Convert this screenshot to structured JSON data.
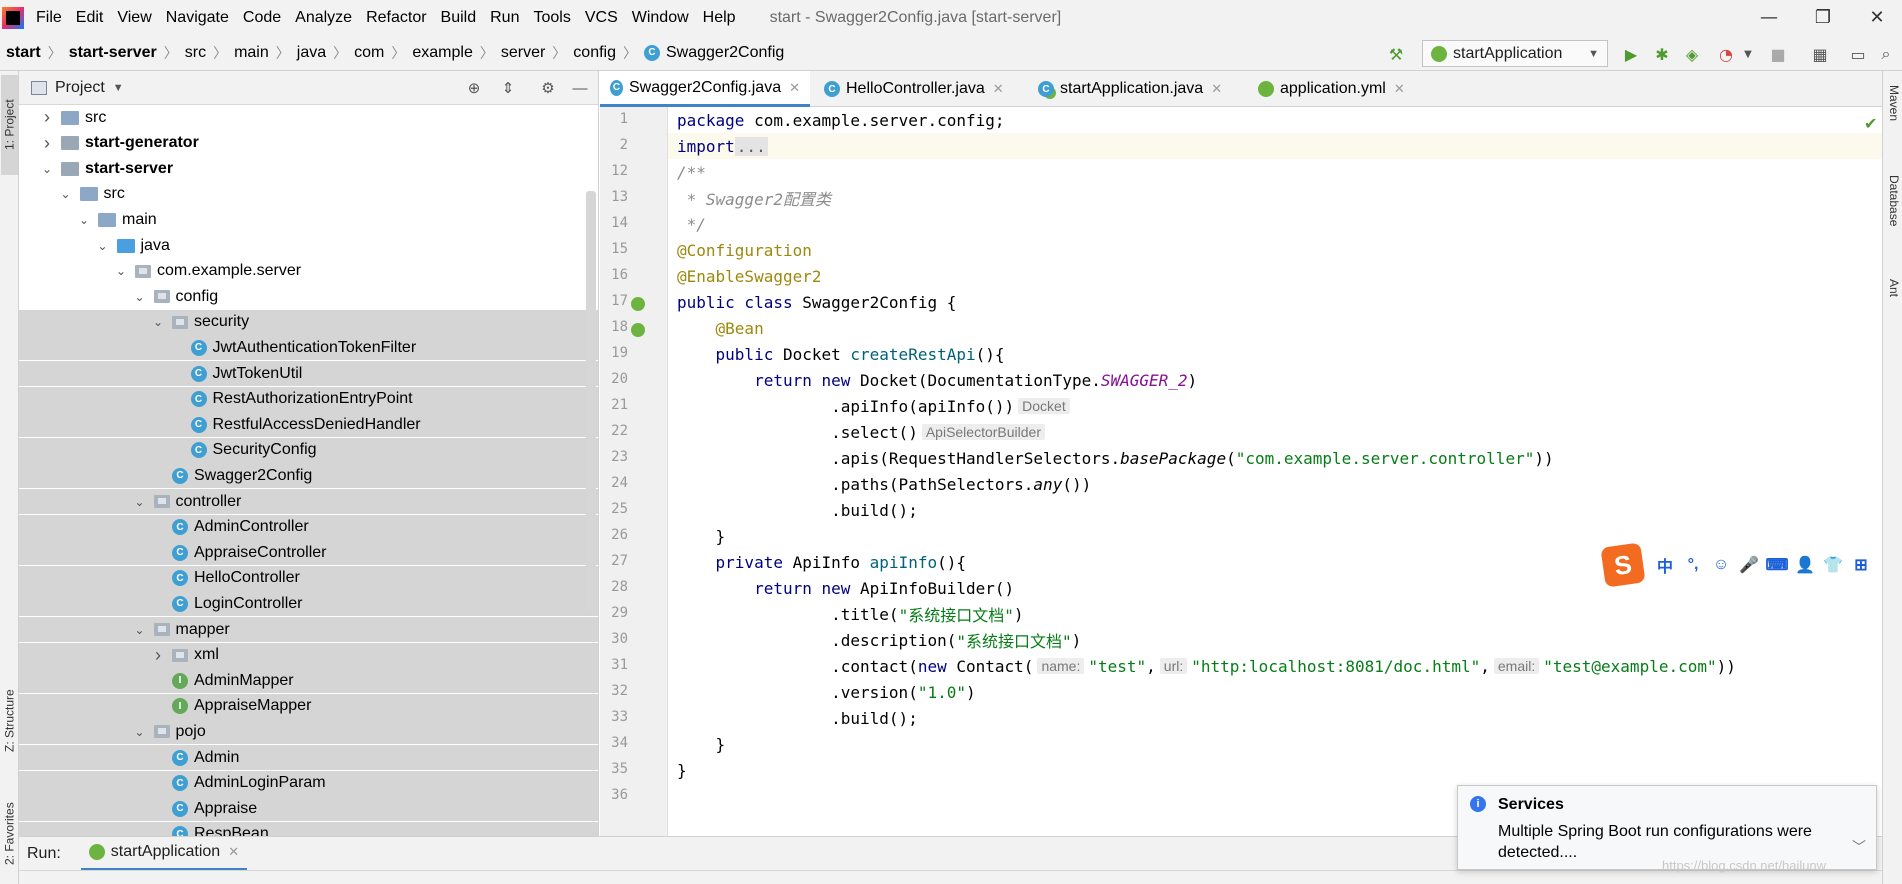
{
  "menubar": {
    "items": [
      "File",
      "Edit",
      "View",
      "Navigate",
      "Code",
      "Analyze",
      "Refactor",
      "Build",
      "Run",
      "Tools",
      "VCS",
      "Window",
      "Help"
    ],
    "window_title": "start - Swagger2Config.java [start-server]"
  },
  "breadcrumb": [
    "start",
    "start-server",
    "src",
    "main",
    "java",
    "com",
    "example",
    "server",
    "config",
    "Swagger2Config"
  ],
  "toolbar": {
    "run_config": "startApplication"
  },
  "left_tabs": [
    "1: Project",
    "Z: Structure",
    "2: Favorites"
  ],
  "right_tabs": [
    "Maven",
    "Database",
    "Ant"
  ],
  "project": {
    "title": "Project",
    "tree": [
      {
        "label": "src",
        "icon": "folder-icon",
        "depth": 1,
        "arrow": "right",
        "bold": false
      },
      {
        "label": "start-generator",
        "icon": "module-icon",
        "depth": 1,
        "arrow": "right",
        "bold": true
      },
      {
        "label": "start-server",
        "icon": "module-icon",
        "depth": 1,
        "arrow": "down",
        "bold": true
      },
      {
        "label": "src",
        "icon": "folder-icon",
        "depth": 2,
        "arrow": "down",
        "bold": false
      },
      {
        "label": "main",
        "icon": "folder-icon",
        "depth": 3,
        "arrow": "down",
        "bold": false
      },
      {
        "label": "java",
        "icon": "source-folder-icon",
        "depth": 4,
        "arrow": "down",
        "bold": false
      },
      {
        "label": "com.example.server",
        "icon": "package-icon",
        "depth": 5,
        "arrow": "down",
        "bold": false
      },
      {
        "label": "config",
        "icon": "package-icon",
        "depth": 6,
        "arrow": "down",
        "bold": false
      },
      {
        "label": "security",
        "icon": "package-icon",
        "depth": 7,
        "arrow": "down",
        "bold": false
      },
      {
        "label": "JwtAuthenticationTokenFilter",
        "icon": "class-icon",
        "depth": 8,
        "arrow": "",
        "bold": false
      },
      {
        "label": "JwtTokenUtil",
        "icon": "class-icon",
        "depth": 8,
        "arrow": "",
        "bold": false
      },
      {
        "label": "RestAuthorizationEntryPoint",
        "icon": "class-icon",
        "depth": 8,
        "arrow": "",
        "bold": false
      },
      {
        "label": "RestfulAccessDeniedHandler",
        "icon": "class-icon",
        "depth": 8,
        "arrow": "",
        "bold": false
      },
      {
        "label": "SecurityConfig",
        "icon": "class-icon",
        "depth": 8,
        "arrow": "",
        "bold": false
      },
      {
        "label": "Swagger2Config",
        "icon": "class-icon",
        "depth": 7,
        "arrow": "",
        "bold": false
      },
      {
        "label": "controller",
        "icon": "package-icon",
        "depth": 6,
        "arrow": "down",
        "bold": false
      },
      {
        "label": "AdminController",
        "icon": "class-icon",
        "depth": 7,
        "arrow": "",
        "bold": false
      },
      {
        "label": "AppraiseController",
        "icon": "class-icon",
        "depth": 7,
        "arrow": "",
        "bold": false
      },
      {
        "label": "HelloController",
        "icon": "class-icon",
        "depth": 7,
        "arrow": "",
        "bold": false
      },
      {
        "label": "LoginController",
        "icon": "class-icon",
        "depth": 7,
        "arrow": "",
        "bold": false
      },
      {
        "label": "mapper",
        "icon": "package-icon",
        "depth": 6,
        "arrow": "down",
        "bold": false
      },
      {
        "label": "xml",
        "icon": "package-icon",
        "depth": 7,
        "arrow": "right",
        "bold": false
      },
      {
        "label": "AdminMapper",
        "icon": "interface-icon",
        "depth": 7,
        "arrow": "",
        "bold": false
      },
      {
        "label": "AppraiseMapper",
        "icon": "interface-icon",
        "depth": 7,
        "arrow": "",
        "bold": false
      },
      {
        "label": "pojo",
        "icon": "package-icon",
        "depth": 6,
        "arrow": "down",
        "bold": false
      },
      {
        "label": "Admin",
        "icon": "class-icon",
        "depth": 7,
        "arrow": "",
        "bold": false
      },
      {
        "label": "AdminLoginParam",
        "icon": "class-icon",
        "depth": 7,
        "arrow": "",
        "bold": false
      },
      {
        "label": "Appraise",
        "icon": "class-icon",
        "depth": 7,
        "arrow": "",
        "bold": false
      },
      {
        "label": "RespBean",
        "icon": "class-icon",
        "depth": 7,
        "arrow": "",
        "bold": false
      }
    ]
  },
  "tabs": [
    {
      "label": "Swagger2Config.java",
      "icon": "class-icon",
      "active": true
    },
    {
      "label": "HelloController.java",
      "icon": "class-icon",
      "active": false
    },
    {
      "label": "startApplication.java",
      "icon": "spring-class-icon",
      "active": false
    },
    {
      "label": "application.yml",
      "icon": "spring-config-icon",
      "active": false
    }
  ],
  "editor": {
    "line_numbers": [
      "1",
      "2",
      "12",
      "13",
      "14",
      "15",
      "16",
      "17",
      "18",
      "19",
      "20",
      "21",
      "22",
      "23",
      "24",
      "25",
      "26",
      "27",
      "28",
      "29",
      "30",
      "31",
      "32",
      "33",
      "34",
      "35",
      "36"
    ],
    "lines": {
      "l1a": "package",
      "l1b": " com.example.server.config;",
      "l2a": "import",
      "l2b": "...",
      "l12": "/**",
      "l13": " * Swagger2配置类",
      "l14": " */",
      "l15": "@Configuration",
      "l16": "@EnableSwagger2",
      "l17a": "public class",
      "l17b": " Swagger2Config {",
      "l18": "    @Bean",
      "l19a": "    public",
      "l19b": " Docket ",
      "l19c": "createRestApi",
      "l19d": "(){",
      "l20a": "        return new",
      "l20b": " Docket(DocumentationType.",
      "l20c": "SWAGGER_2",
      "l20d": ")",
      "l21a": "                .apiInfo(apiInfo())",
      "l21hint": "Docket",
      "l22a": "                .select()",
      "l22hint": "ApiSelectorBuilder",
      "l23a": "                .apis(RequestHandlerSelectors.",
      "l23b": "basePackage",
      "l23c": "(",
      "l23d": "\"com.example.server.controller\"",
      "l23e": "))",
      "l24a": "                .paths(PathSelectors.",
      "l24b": "any",
      "l24c": "())",
      "l25": "                .build();",
      "l26": "    }",
      "l27a": "    private",
      "l27b": " ApiInfo ",
      "l27c": "apiInfo",
      "l27d": "(){",
      "l28a": "        return new",
      "l28b": " ApiInfoBuilder()",
      "l29a": "                .title(",
      "l29b": "\"系统接口文档\"",
      "l29c": ")",
      "l30a": "                .description(",
      "l30b": "\"系统接口文档\"",
      "l30c": ")",
      "l31a": "                .contact(",
      "l31b": "new",
      "l31c": " Contact(",
      "l31h1": "name:",
      "l31d": "\"test\"",
      "l31e": ",",
      "l31h2": "url:",
      "l31f": "\"http:localhost:8081/doc.html\"",
      "l31g": ",",
      "l31h3": "email:",
      "l31i": "\"test@example.com\"",
      "l31j": "))",
      "l32a": "                .version(",
      "l32b": "\"1.0\"",
      "l32c": ")",
      "l33": "                .build();",
      "l34": "    }",
      "l35": "}"
    }
  },
  "runbar": {
    "label": "Run:",
    "tab": "startApplication"
  },
  "notification": {
    "title": "Services",
    "body": "Multiple Spring Boot run configurations were detected...."
  },
  "ime": {
    "logo": "S",
    "items": [
      "中",
      "°,",
      "☺",
      "🎤",
      "⌨",
      "👤",
      "👕",
      "⊞"
    ]
  },
  "watermark": "https://blog.csdn.net/hailunw",
  "colors": {
    "keyword": "#000080",
    "string": "#067d17",
    "annotation": "#9e880d",
    "comment": "#8c8c8c",
    "method": "#00627a",
    "static_field": "#871094",
    "active_tab_underline": "#4083c9",
    "selection": "#d5d5d5"
  }
}
